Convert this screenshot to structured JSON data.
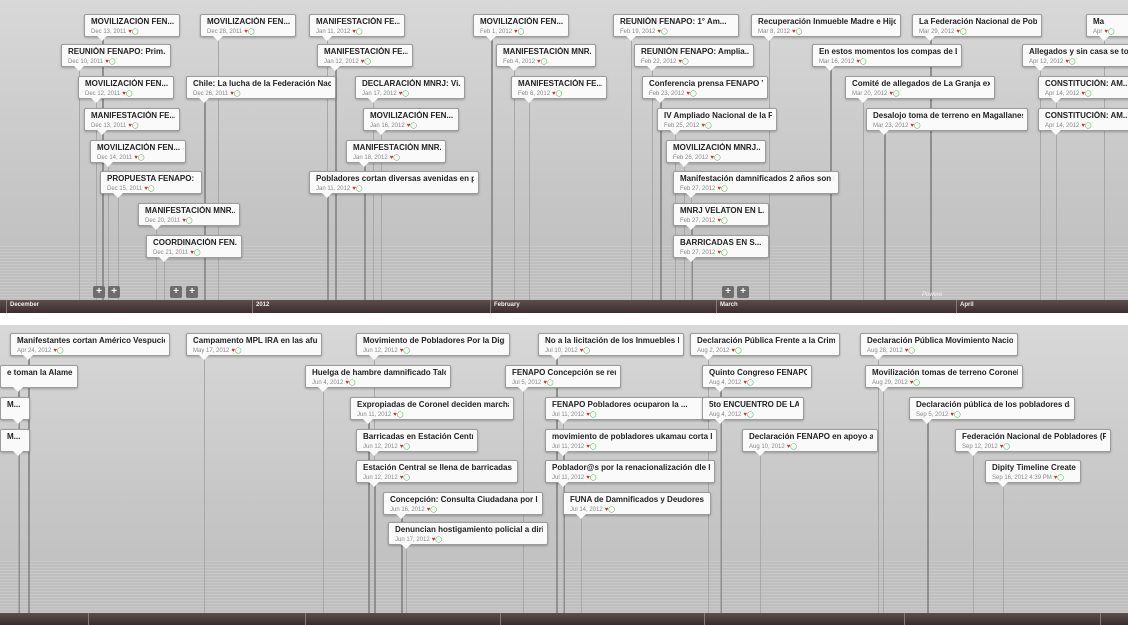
{
  "icons": {
    "heart": "♥",
    "comment": "◯"
  },
  "top": {
    "axis_labels": [
      "December",
      "2012",
      "February",
      "March",
      "April"
    ],
    "powered_label": "Powere",
    "plus_buttons": [
      "+",
      "+",
      "+",
      "+",
      "+",
      "+"
    ],
    "events": [
      {
        "title": "MOVILIZACIÓN FEN...",
        "date": "Dec 13, 2011"
      },
      {
        "title": "MOVILIZACIÓN FEN...",
        "date": "Dec 28, 2011"
      },
      {
        "title": "MANIFESTACIÓN FE...",
        "date": "Jan 11, 2012"
      },
      {
        "title": "MOVILIZACIÓN FEN...",
        "date": "Feb 1, 2012"
      },
      {
        "title": "REUNIÓN FENAPO: 1° Am...",
        "date": "Feb 19, 2012"
      },
      {
        "title": "Recuperación Inmueble Madre e Hijo",
        "date": "Mar 8, 2012"
      },
      {
        "title": "La Federación Nacional de Pobladores ...",
        "date": "Mar 29, 2012"
      },
      {
        "title": "Ma",
        "date": "Apr"
      },
      {
        "title": "REUNIÓN FENAPO: Prim...",
        "date": "Dec 10, 2011"
      },
      {
        "title": "MANIFESTACIÓN FE...",
        "date": "Jan 12, 2012"
      },
      {
        "title": "MANIFESTACIÓN MNR...",
        "date": "Feb 4, 2012"
      },
      {
        "title": "REUNIÓN FENAPO: Amplia...",
        "date": "Feb 22, 2012"
      },
      {
        "title": "En estos momentos los compas de Lo ...",
        "date": "Mar 16, 2012"
      },
      {
        "title": "Allegados y sin casa se tom",
        "date": "Apr 12, 2012"
      },
      {
        "title": "MOVILIZACIÓN FEN...",
        "date": "Dec 12, 2011"
      },
      {
        "title": "Chile: La lucha de la Federación Naci...",
        "date": "Dec 26, 2011"
      },
      {
        "title": "DECLARACIÓN MNRJ: Vi...",
        "date": "Jan 17, 2012"
      },
      {
        "title": "MANIFESTACIÓN FE...",
        "date": "Feb 6, 2012"
      },
      {
        "title": "Conferencia prensa FENAPO Y...",
        "date": "Feb 23, 2012"
      },
      {
        "title": "Comité de allegados de La Granja exig...",
        "date": "Mar 20, 2012"
      },
      {
        "title": "CONSTITUCIÓN: AM...",
        "date": "Apr 14, 2012"
      },
      {
        "title": "MANIFESTACIÓN FE...",
        "date": "Dec 13, 2011"
      },
      {
        "title": "MOVILIZACIÓN FEN...",
        "date": "Jan 16, 2012"
      },
      {
        "title": "IV Ampliado Nacional de la F...",
        "date": "Feb 25, 2012"
      },
      {
        "title": "Desalojo toma de terreno en Magallanes",
        "date": "Mar 23, 2012"
      },
      {
        "title": "CONSTITUCIÓN: AM...",
        "date": "Apr 14, 2012"
      },
      {
        "title": "MOVILIZACIÓN FEN...",
        "date": "Dec 14, 2011"
      },
      {
        "title": "MANIFESTACIÓN MNR...",
        "date": "Jan 18, 2012"
      },
      {
        "title": "MOVILIZACIÓN MNRJ...",
        "date": "Feb 26, 2012"
      },
      {
        "title": "PROPUESTA FENAPO: ...",
        "date": "Dec 15, 2011"
      },
      {
        "title": "Pobladores cortan diversas avenidas en pr...",
        "date": "Jan 11, 2012"
      },
      {
        "title": "Manifestación damnificados 2 años son r...",
        "date": "Feb 27, 2012"
      },
      {
        "title": "MANIFESTACIÓN MNR...",
        "date": "Dec 20, 2011"
      },
      {
        "title": "MNRJ VELATON EN L...",
        "date": "Feb 27, 2012"
      },
      {
        "title": "COORDINACIÓN FEN...",
        "date": "Dec 21, 2011"
      },
      {
        "title": "BARRICADAS EN S...",
        "date": "Feb 27, 2012"
      }
    ]
  },
  "bottom": {
    "events": [
      {
        "title": "Manifestantes cortan Américo Vespucio...",
        "date": "Apr 24, 2012"
      },
      {
        "title": "Campamento MPL IRA en las afue...",
        "date": "May 17, 2012"
      },
      {
        "title": "Movimiento de Pobladores Por la Dign...",
        "date": "Jun 12, 2012"
      },
      {
        "title": "No a la licitación de los Inmuebles R...",
        "date": "Jul 10, 2012"
      },
      {
        "title": "Declaración Pública Frente a la Crim...",
        "date": "Aug 2, 2012"
      },
      {
        "title": "Declaración Pública Movimiento Nacio...",
        "date": "Aug 28, 2012"
      },
      {
        "title": "e toman la Alame...",
        "date": ""
      },
      {
        "title": "Huelga de hambre damnificado Talca...",
        "date": "Jun 4, 2012"
      },
      {
        "title": "FENAPO Concepción se reune",
        "date": "Jul 5, 2012"
      },
      {
        "title": "Quinto Congreso FENAPO",
        "date": "Aug 4, 2012"
      },
      {
        "title": "Movilización tomas de terreno Coronel...",
        "date": "Aug 29, 2012"
      },
      {
        "title": "M...",
        "date": ""
      },
      {
        "title": "Expropiadas de Coronel deciden marchar...",
        "date": "Jun 11, 2012"
      },
      {
        "title": "FENAPO Pobladores ocuparon la ...",
        "date": "Jul 11, 2012"
      },
      {
        "title": "5to ENCUENTRO DE LA...",
        "date": "Aug 4, 2012"
      },
      {
        "title": "Declaración pública de los pobladores da...",
        "date": "Sep 5, 2012"
      },
      {
        "title": "M...",
        "date": ""
      },
      {
        "title": "Barricadas en Estación Central",
        "date": "Jun 12, 2012"
      },
      {
        "title": "movimiento de pobladores ukamau corta la...",
        "date": "Jul 11, 2012"
      },
      {
        "title": "Declaración FENAPO en apoyo a ...",
        "date": "Aug 10, 2012"
      },
      {
        "title": "Federación Nacional de Pobladores (F...",
        "date": "Sep 12, 2012"
      },
      {
        "title": "Estación Central se llena de barricadas ...",
        "date": "Jun 12, 2012"
      },
      {
        "title": "Poblador@s por la renacionalización dle lo...",
        "date": "Jul 11, 2012"
      },
      {
        "title": "Dipity Timeline Created",
        "date": "Sep 16, 2012 4:39 PM"
      },
      {
        "title": "Concepción: Consulta Ciudadana por la...",
        "date": "Jun 16, 2012"
      },
      {
        "title": "FUNA de Damnificados y Deudores ...",
        "date": "Jul 14, 2012"
      },
      {
        "title": "Denuncian hostigamiento policial a dirig...",
        "date": "Jun 17, 2012"
      }
    ]
  }
}
